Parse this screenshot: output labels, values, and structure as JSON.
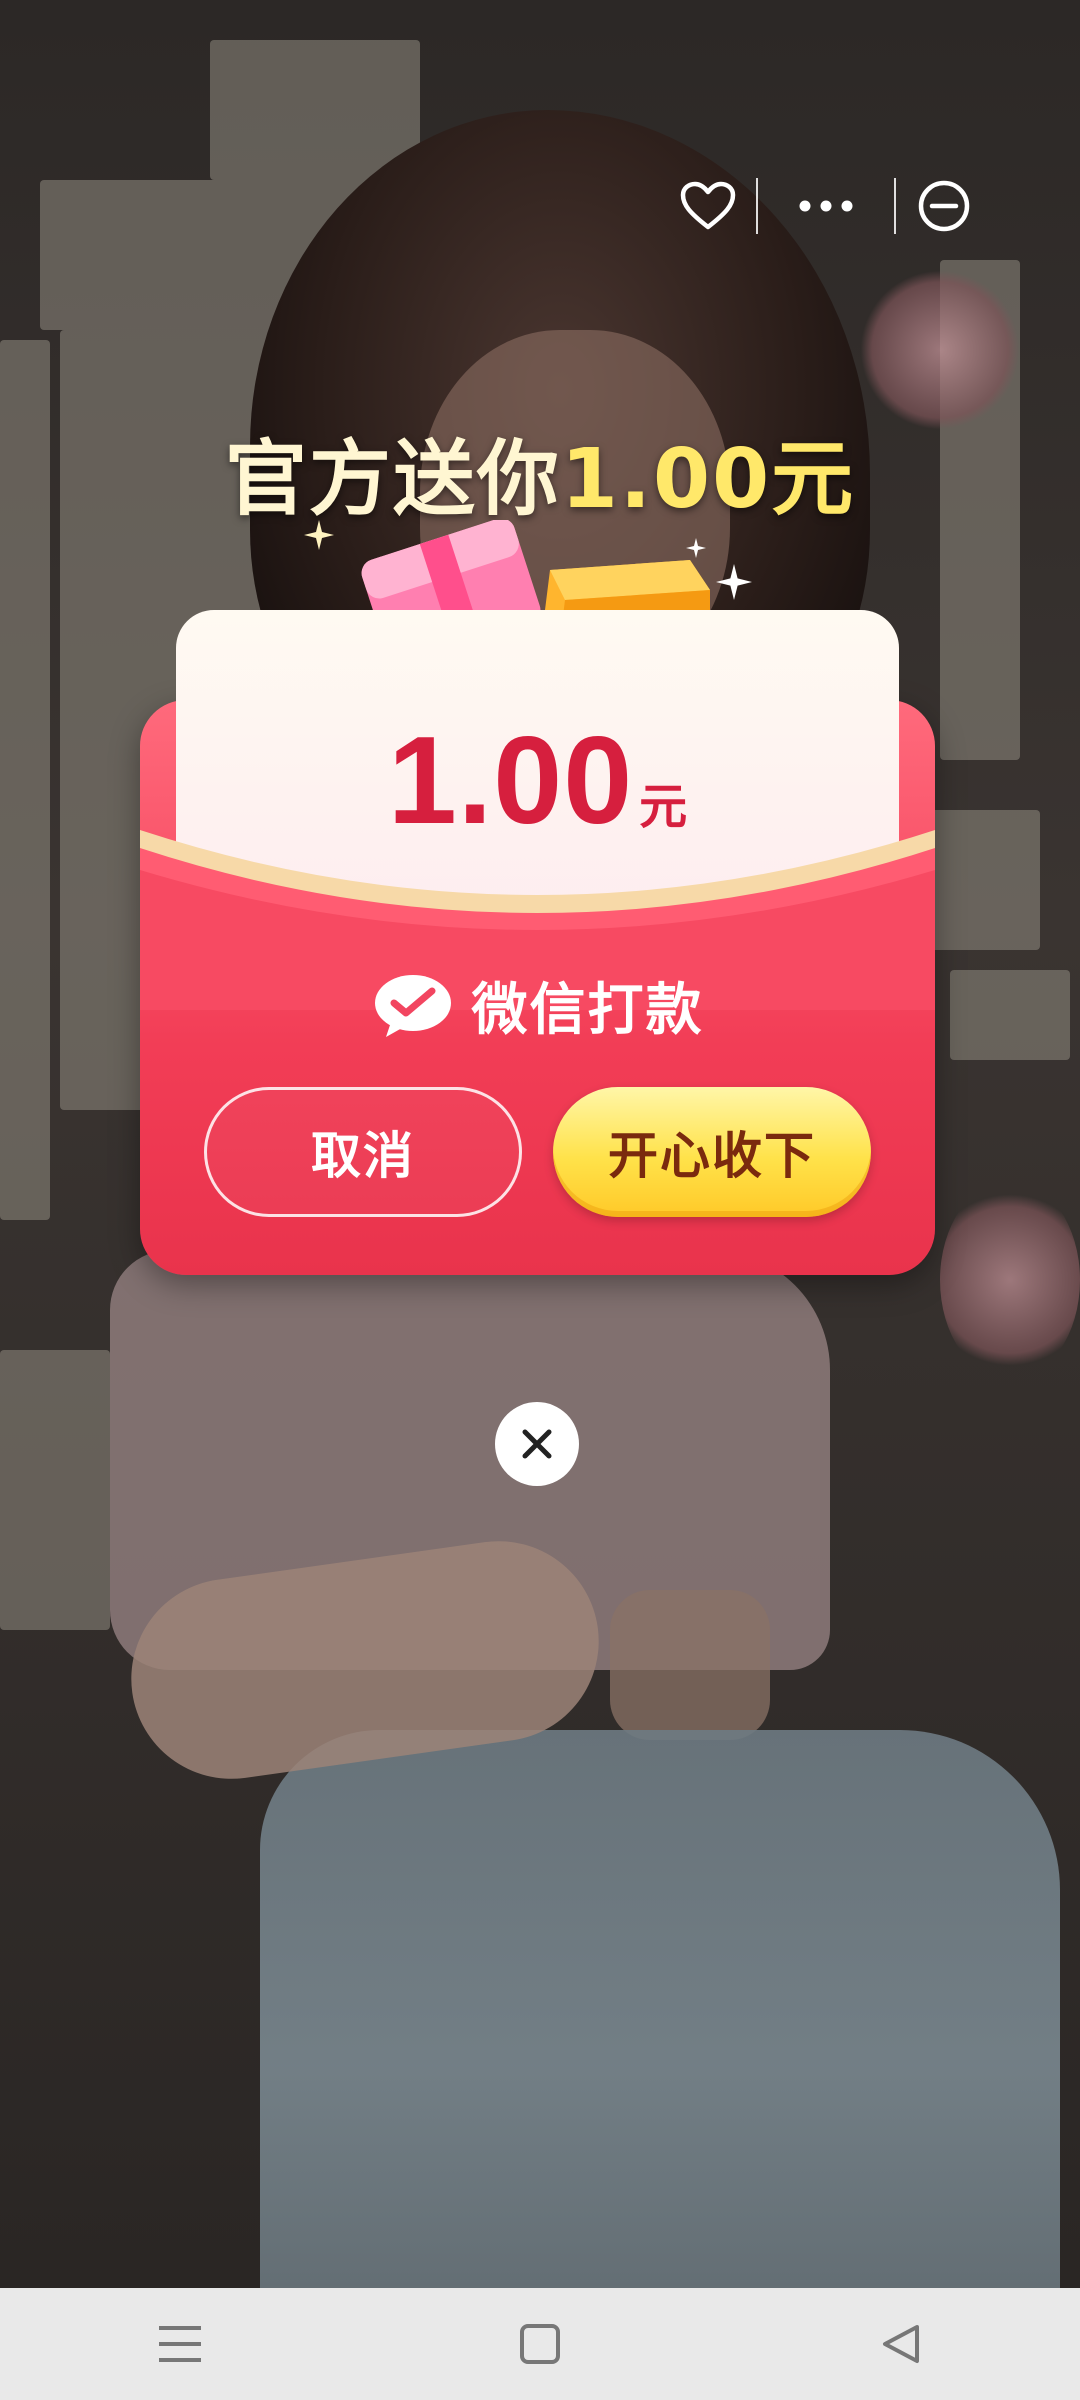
{
  "popup": {
    "title_prefix": "官方送你",
    "title_amount": "1.00元",
    "amount_value": "1.00",
    "amount_unit": "元",
    "payment_label": "微信打款",
    "cancel_label": "取消",
    "accept_label": "开心收下"
  },
  "icons": {
    "favorite": "heart-icon",
    "more": "more-icon",
    "minimize": "minus-circle-icon",
    "close": "close-icon",
    "wechat": "wechat-pay-icon",
    "nav_menu": "menu-icon",
    "nav_home": "home-square-icon",
    "nav_back": "back-triangle-icon"
  },
  "colors": {
    "envelope_red": "#f23d56",
    "amount_red": "#d61f3e",
    "accept_yellow": "#ffe24a",
    "title_yellow": "#ffe86a"
  }
}
